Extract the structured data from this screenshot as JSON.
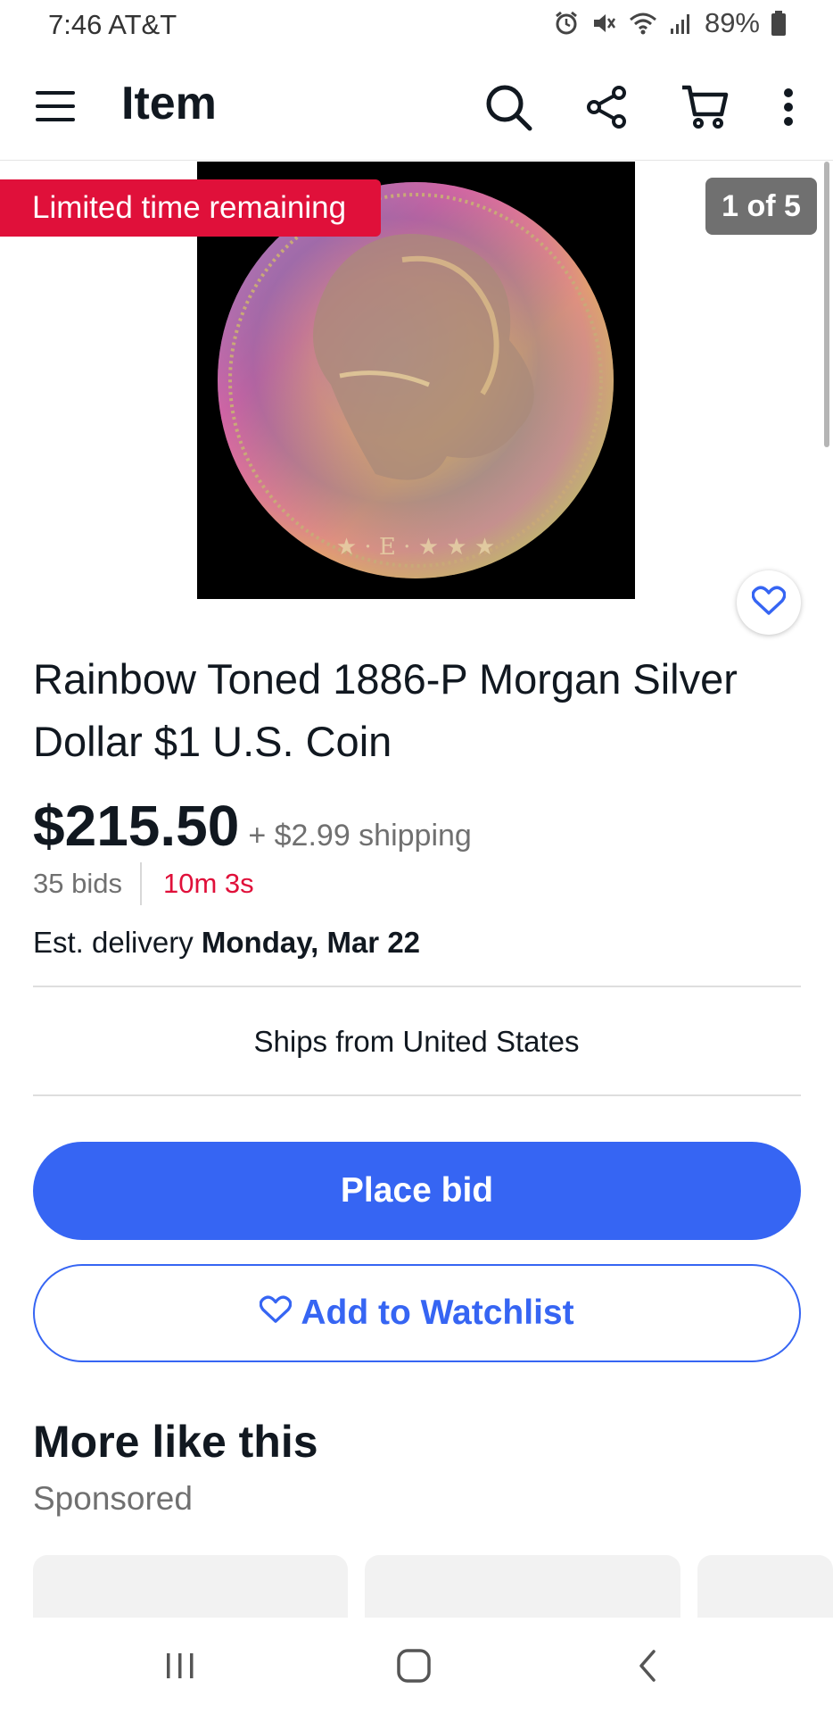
{
  "status_bar": {
    "time_carrier": "7:46 AT&T",
    "battery": "89%",
    "icons": [
      "alarm-icon",
      "mute-icon",
      "wifi-icon",
      "signal-icon",
      "battery-icon"
    ]
  },
  "app_bar": {
    "title": "Item",
    "icons": [
      "menu-icon",
      "search-icon",
      "share-icon",
      "cart-icon",
      "more-icon"
    ]
  },
  "gallery": {
    "badge": "Limited time remaining",
    "counter": "1 of 5",
    "image_subject": "rainbow toned Morgan silver dollar coin"
  },
  "listing": {
    "title": "Rainbow Toned 1886-P Morgan Silver Dollar $1 U.S. Coin",
    "price": "$215.50",
    "shipping": "+ $2.99 shipping",
    "bids": "35 bids",
    "time_left": "10m 3s",
    "delivery_prefix": "Est. delivery",
    "delivery_date": "Monday, Mar 22",
    "ships_from": "Ships from United States"
  },
  "actions": {
    "place_bid": "Place bid",
    "add_to_watchlist": "Add to Watchlist"
  },
  "more_like_this": {
    "title": "More like this",
    "subtitle": "Sponsored"
  },
  "colors": {
    "accent_blue": "#3665f3",
    "alert_red": "#e0103a",
    "text_dark": "#111820",
    "text_muted": "#707070"
  }
}
